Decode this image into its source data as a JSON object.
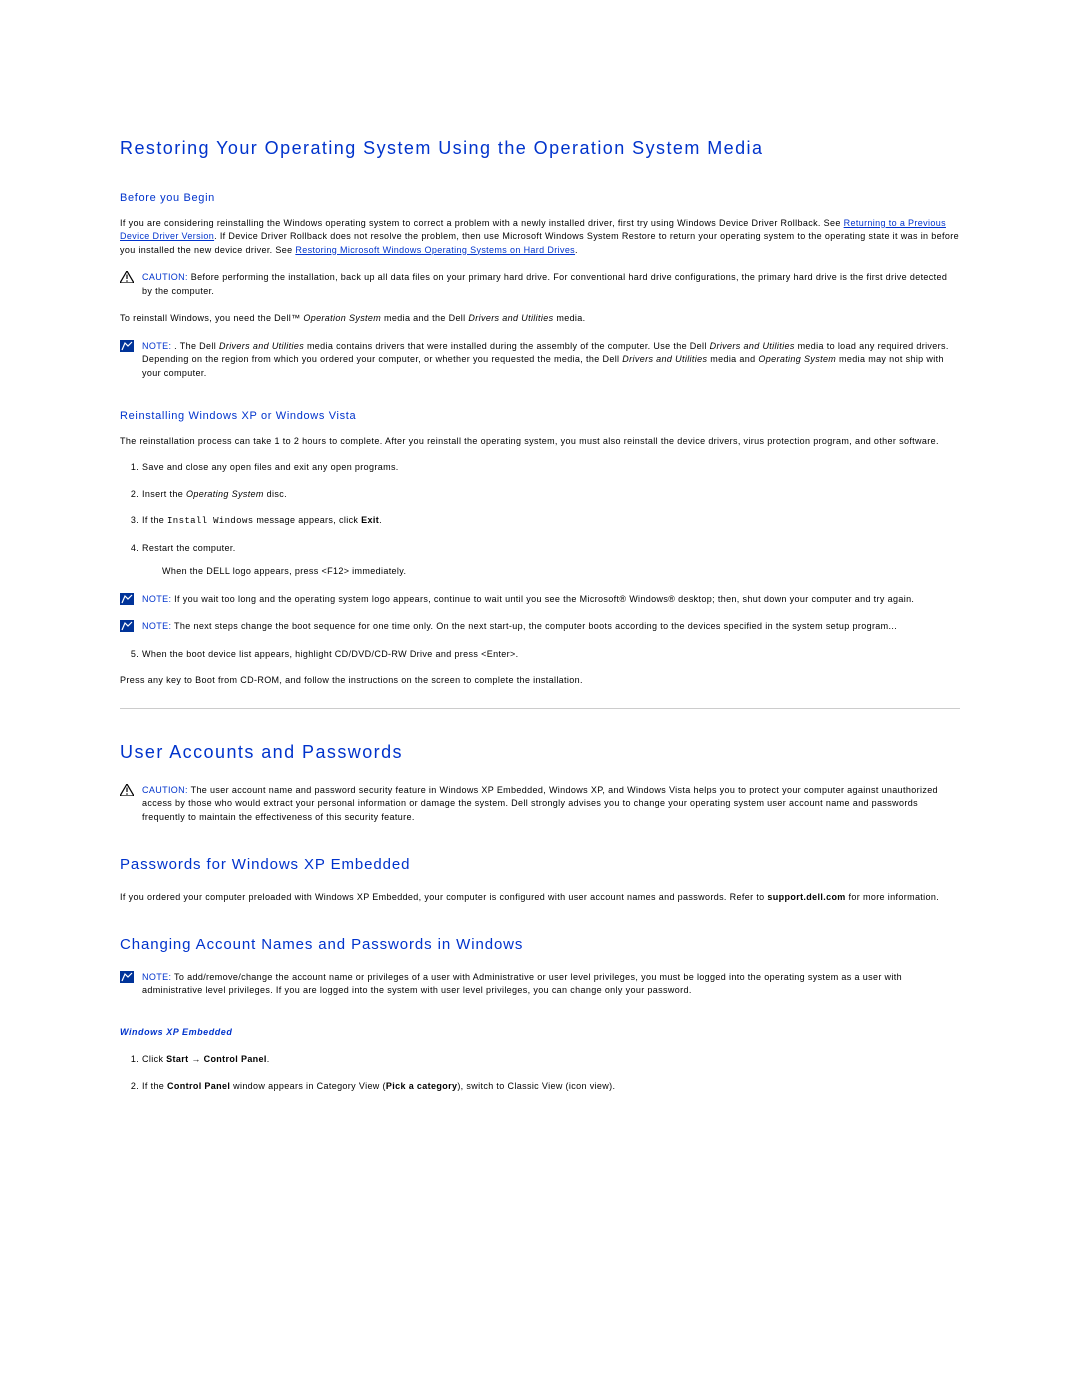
{
  "h2_restore": "Restoring Your Operating System Using the Operation System Media",
  "h4_before": "Before you Begin",
  "p_before_1a": "If you are considering reinstalling the Windows operating system to correct a problem with a newly installed driver, first try using Windows Device Driver Rollback. See ",
  "link_prev_driver": "Returning to a Previous Device Driver Version",
  "p_before_1b": ". If Device Driver Rollback does not resolve the problem, then use Microsoft Windows System Restore to return your operating system to the operating state it was in before you installed the new device driver. See ",
  "link_restore_ms": "Restoring Microsoft Windows Operating Systems on Hard Drives",
  "p_before_1c": ".",
  "caution_label": "CAUTION:",
  "caution_1": " Before performing the installation, back up all data files on your primary hard drive. For conventional hard drive configurations, the primary hard drive is the first drive detected by the computer.",
  "p_reinstall_pre": "To reinstall Windows, you need the Dell™ ",
  "p_reinstall_os": "Operation System",
  "p_reinstall_mid": " media and the Dell ",
  "p_reinstall_du": "Drivers and Utilities",
  "p_reinstall_post": " media.",
  "note_label": "NOTE:",
  "note_1a": " . The Dell ",
  "note_1b": "Drivers and Utilities",
  "note_1c": " media contains drivers that were installed during the assembly of the computer. Use the Dell ",
  "note_1d": "Drivers and Utilities",
  "note_1e": " media to load any required drivers. Depending on the region from which you ordered your computer, or whether you requested the media, the Dell ",
  "note_1f": "Drivers and Utilities",
  "note_1g": " media and ",
  "note_1h": "Operating System",
  "note_1i": " media may not ship with your computer.",
  "h4_reinstall": "Reinstalling Windows XP or Windows Vista",
  "p_reinstall_proc": "The reinstallation process can take 1 to 2 hours to complete. After you reinstall the operating system, you must also reinstall the device drivers, virus protection program, and other software.",
  "step1": "Save and close any open files and exit any open programs.",
  "step2a": "Insert the ",
  "step2b": "Operating System",
  "step2c": " disc.",
  "step3a": "If the ",
  "step3b": "Install Windows",
  "step3c": " message appears, click ",
  "step3d": "Exit",
  "step3e": ".",
  "step4": "Restart the computer.",
  "step4_sub": "When the DELL logo appears, press <F12> immediately.",
  "note_2": " If you wait too long and the operating system logo appears, continue to wait until you see the Microsoft® Windows® desktop; then, shut down your computer and try again.",
  "note_3": " The next steps change the boot sequence for one time only. On the next start-up, the computer boots according to the devices specified in the system setup program...",
  "step5": "When the boot device list appears, highlight CD/DVD/CD-RW Drive and press <Enter>.",
  "p_press_any": "Press any key to Boot from CD-ROM, and follow the instructions on the screen to complete the installation.",
  "h2_accounts": "User Accounts and Passwords",
  "caution_2": " The user account name and password security feature in Windows XP Embedded, Windows XP, and Windows Vista helps you to protect your computer against unauthorized access by those who would extract your personal information or damage the system. Dell strongly advises you to change your operating system user account name and passwords frequently to maintain the effectiveness of this security feature.",
  "h3_pw_xpe": "Passwords for Windows XP Embedded",
  "p_xpe_pre": "If you ordered your computer preloaded with Windows XP Embedded, your computer is configured with user account names and passwords. Refer to ",
  "p_xpe_bold": "support.dell.com",
  "p_xpe_post": " for more information.",
  "h3_change": "Changing Account Names and Passwords in Windows",
  "note_4": " To add/remove/change the account name or privileges of a user with Administrative or user level privileges, you must be logged into the operating system as a user with administrative level privileges. If you are logged into the system with user level privileges, you can change only your password.",
  "h5_xpe": "Windows XP Embedded",
  "xpe_step1a": "Click ",
  "xpe_step1b": "Start",
  "xpe_step1c": " → ",
  "xpe_step1d": "Control Panel",
  "xpe_step1e": ".",
  "xpe_step2a": "If the ",
  "xpe_step2b": "Control Panel",
  "xpe_step2c": " window appears in Category View (",
  "xpe_step2d": "Pick a category",
  "xpe_step2e": "), switch to Classic View (icon view)."
}
